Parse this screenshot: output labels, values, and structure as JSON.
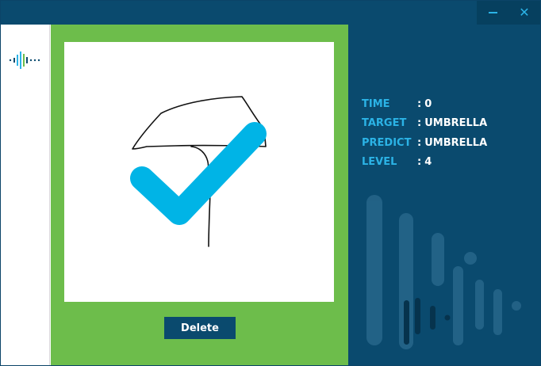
{
  "window_controls": {
    "minimize_icon": "minimize-icon",
    "close_glyph": "✕"
  },
  "sidebar": {
    "logo_icon": "sound-wave-logo-icon"
  },
  "canvas": {
    "result_icon": "checkmark-icon",
    "drawing": "umbrella-sketch"
  },
  "actions": {
    "delete_label": "Delete"
  },
  "stats": {
    "separator": ":",
    "time_label": "TIME",
    "time_value": "0",
    "target_label": "TARGET",
    "target_value": "UMBRELLA",
    "predict_label": "PREDICT",
    "predict_value": "UMBRELLA",
    "level_label": "LEVEL",
    "level_value": "4"
  },
  "colors": {
    "titlebar": "#0a4a6e",
    "accent": "#2bb3e6",
    "panel_green": "#6dbd4b",
    "check": "#00b4e6",
    "button": "#0a4a6e"
  }
}
